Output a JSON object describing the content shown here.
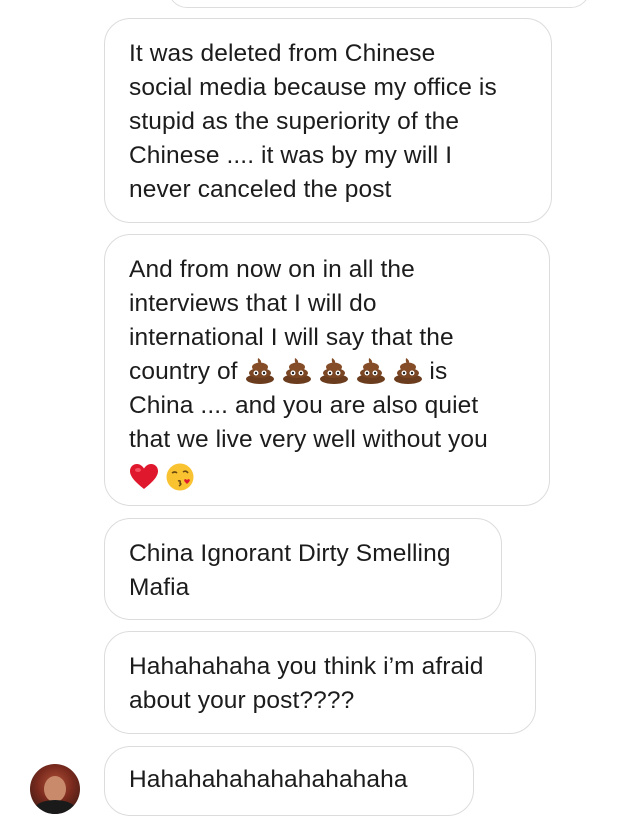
{
  "conversation": {
    "messages": [
      {
        "text": "It was deleted from Chinese\nsocial media because my office is\nstupid as the superiority of the\nChinese .... it was by my will I\nnever canceled the post"
      },
      {
        "text_before": "And from now on in all the\ninterviews that I will do\ninternational I will say that the\ncountry of ",
        "emoji_count": 5,
        "text_after": " is\nChina .... and you are also quiet\nthat we live very well without you",
        "trailing_emojis": [
          "heart-emoji",
          "kissing-face-emoji"
        ]
      },
      {
        "text": "China Ignorant Dirty Smelling\nMafia"
      },
      {
        "text": "Hahahahaha you think i’m afraid\nabout your post????"
      },
      {
        "text": "Hahahahahahahahahaha"
      }
    ],
    "icons": {
      "poop": "pile-of-poo-emoji",
      "heart": "red-heart-emoji",
      "kiss": "face-blowing-kiss-emoji"
    },
    "colors": {
      "bubble_border": "#dcdcdc",
      "text": "#1c1c1c",
      "background": "#ffffff"
    }
  }
}
